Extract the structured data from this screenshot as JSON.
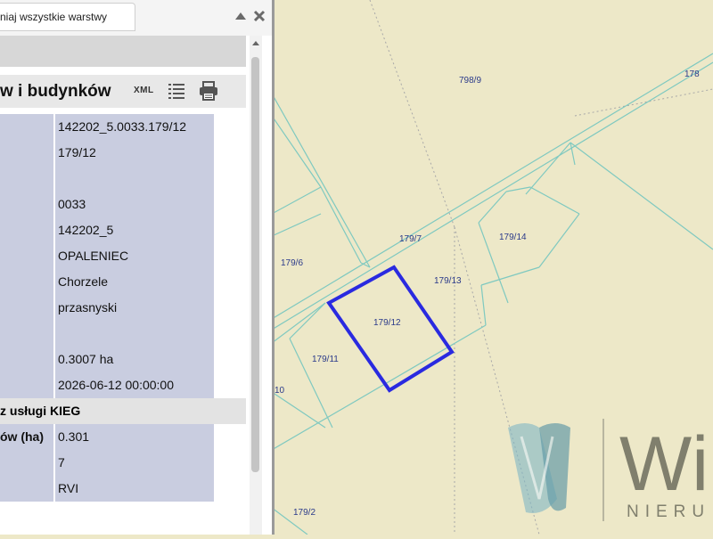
{
  "panel": {
    "tab_label": "niaj wszystkie warstwy",
    "header_title": "w i budynków",
    "xml_label": "XML",
    "rows": [
      {
        "value": "142202_5.0033.179/12"
      },
      {
        "value": "179/12"
      },
      {
        "value": ""
      },
      {
        "value": "0033"
      },
      {
        "value": "142202_5"
      },
      {
        "value": "OPALENIEC"
      },
      {
        "value": "Chorzele"
      },
      {
        "value": "przasnyski"
      },
      {
        "value": ""
      },
      {
        "value": "0.3007 ha"
      },
      {
        "value": "2026-06-12 00:00:00"
      }
    ],
    "section_label": "z usługi KIEG",
    "rows2": [
      {
        "label": "ów (ha)",
        "value": "0.301"
      },
      {
        "label": "",
        "value": "7"
      },
      {
        "label": "",
        "value": "RVI"
      }
    ]
  },
  "map": {
    "parcel_labels": [
      "798/9",
      "178",
      "179/7",
      "179/14",
      "179/6",
      "179/13",
      "179/12",
      "179/11",
      "10",
      "179/2"
    ],
    "highlight_color": "#2a2ae0",
    "map_background": "#ede8c8",
    "line_color": "#7fc9c0"
  },
  "watermark": {
    "text": "Wi",
    "subtext": "NIERU"
  },
  "icons": {
    "close": "close-icon",
    "collapse": "triangle-up-icon",
    "list": "list-icon",
    "print": "printer-icon"
  }
}
